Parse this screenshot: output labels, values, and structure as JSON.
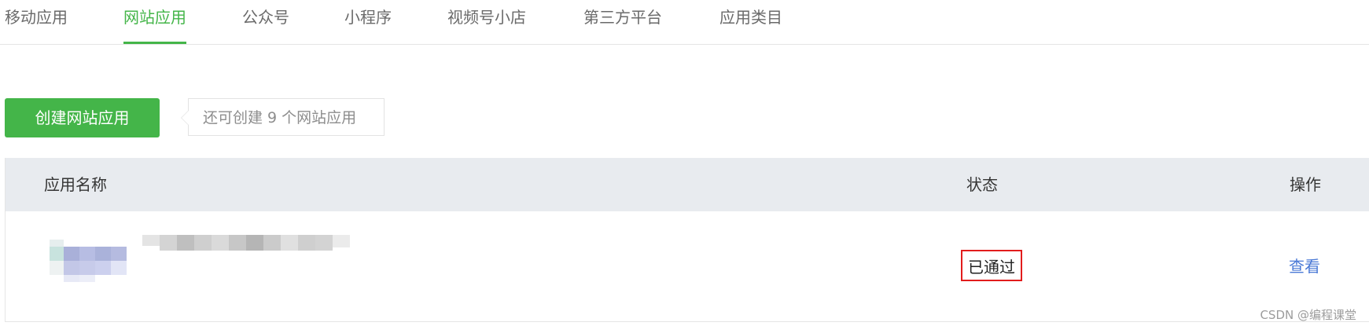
{
  "tabs": [
    {
      "label": "移动应用",
      "active": false
    },
    {
      "label": "网站应用",
      "active": true
    },
    {
      "label": "公众号",
      "active": false
    },
    {
      "label": "小程序",
      "active": false
    },
    {
      "label": "视频号小店",
      "active": false
    },
    {
      "label": "第三方平台",
      "active": false
    },
    {
      "label": "应用类目",
      "active": false
    }
  ],
  "actions": {
    "create_label": "创建网站应用",
    "quota_tip": "还可创建 9 个网站应用"
  },
  "table": {
    "headers": {
      "name": "应用名称",
      "status": "状态",
      "operation": "操作"
    },
    "rows": [
      {
        "status": "已通过",
        "action": "查看"
      }
    ]
  },
  "watermark": "CSDN @编程课堂",
  "colors": {
    "accent": "#44b549",
    "header_bg": "#e8ebef",
    "link": "#4b7ad6",
    "highlight": "#e21c1c"
  }
}
